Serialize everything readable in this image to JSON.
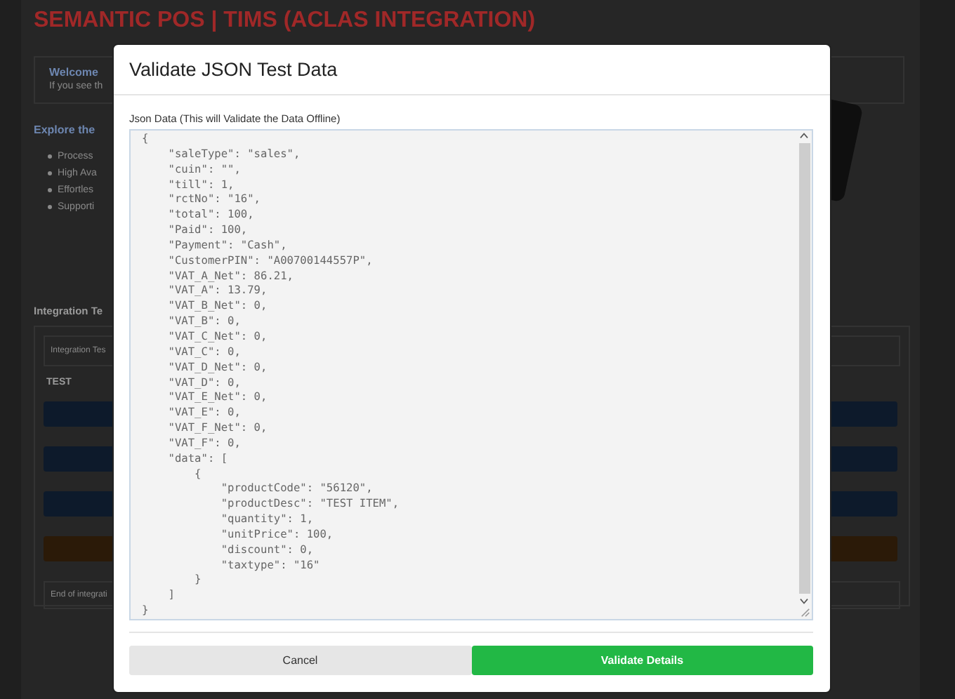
{
  "page": {
    "title": "SEMANTIC POS | TIMS (ACLAS INTEGRATION)",
    "welcome": {
      "heading": "Welcome",
      "text": "If you see th"
    },
    "explore": {
      "heading": "Explore the",
      "bullets": [
        "Process",
        "High Ava",
        "Effortles",
        "Supporti"
      ]
    },
    "integration": {
      "heading": "Integration Te",
      "tab": "Integration Tes",
      "label": "TEST",
      "buttons": [
        {
          "color": "#0d1a2b"
        },
        {
          "color": "#0d1a2b"
        },
        {
          "color": "#0d1a2b"
        },
        {
          "color": "#2b1a08"
        }
      ],
      "footer": "End of integrati"
    }
  },
  "modal": {
    "title": "Validate JSON Test Data",
    "field": {
      "label": "Json Data (This will Validate the Data Offline)",
      "value": "{\n    \"saleType\": \"sales\",\n    \"cuin\": \"\",\n    \"till\": 1,\n    \"rctNo\": \"16\",\n    \"total\": 100,\n    \"Paid\": 100,\n    \"Payment\": \"Cash\",\n    \"CustomerPIN\": \"A00700144557P\",\n    \"VAT_A_Net\": 86.21,\n    \"VAT_A\": 13.79,\n    \"VAT_B_Net\": 0,\n    \"VAT_B\": 0,\n    \"VAT_C_Net\": 0,\n    \"VAT_C\": 0,\n    \"VAT_D_Net\": 0,\n    \"VAT_D\": 0,\n    \"VAT_E_Net\": 0,\n    \"VAT_E\": 0,\n    \"VAT_F_Net\": 0,\n    \"VAT_F\": 0,\n    \"data\": [\n        {\n            \"productCode\": \"56120\",\n            \"productDesc\": \"TEST ITEM\",\n            \"quantity\": 1,\n            \"unitPrice\": 100,\n            \"discount\": 0,\n            \"taxtype\": \"16\"\n        }\n    ]\n}"
    },
    "buttons": [
      {
        "label": "Cancel",
        "kind": "secondary"
      },
      {
        "label": "Validate Details",
        "kind": "primary"
      }
    ]
  }
}
